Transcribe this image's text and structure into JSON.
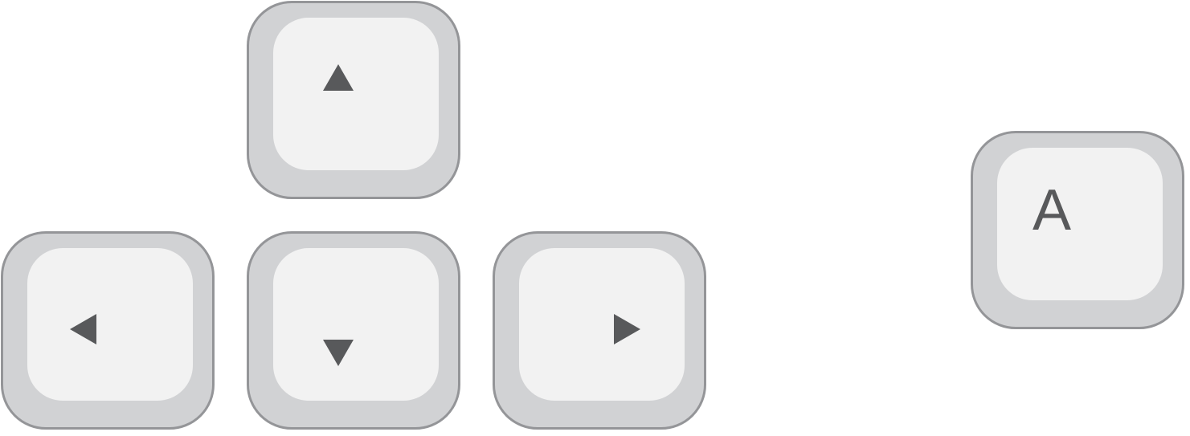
{
  "keys": {
    "up": {
      "icon": "arrow-up-icon"
    },
    "left": {
      "icon": "arrow-left-icon"
    },
    "down": {
      "icon": "arrow-down-icon"
    },
    "right": {
      "icon": "arrow-right-icon"
    },
    "a": {
      "label": "A"
    }
  },
  "colors": {
    "key_border": "#949598",
    "key_body": "#d1d2d4",
    "key_cap": "#f2f2f2",
    "glyph": "#58595b",
    "background": "#ffffff"
  }
}
